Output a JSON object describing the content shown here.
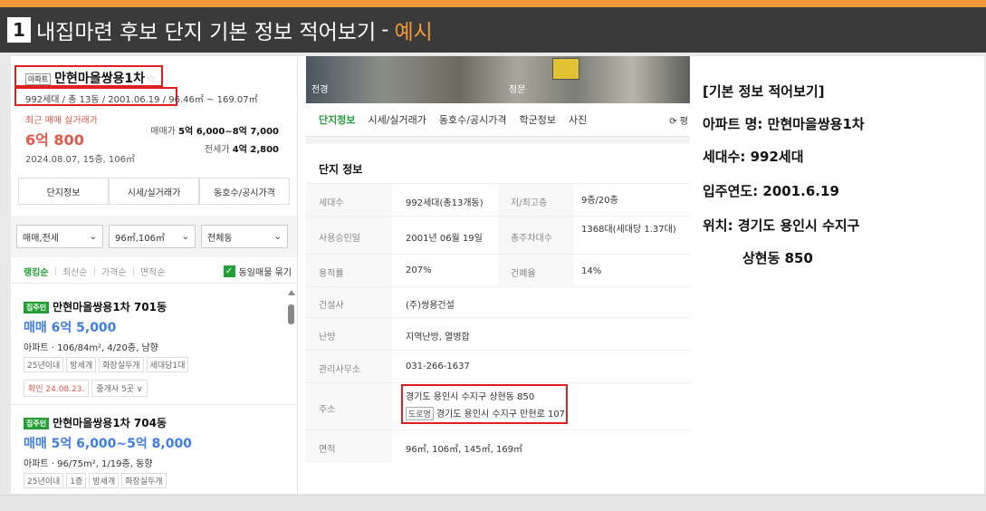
{
  "header": {
    "number": "1",
    "title": "내집마련 후보 단지 기본 정보 적어보기",
    "separator": "-",
    "example": "예시"
  },
  "left": {
    "type_tag": "아파트",
    "name": "만현마을쌍용1차",
    "star": "☆",
    "info": "992세대 / 총 13동 / 2001.06.19 / 96.46㎡ ~ 169.07㎡",
    "recent_label": "최근 매매 실거래가",
    "recent_price": "6억 800",
    "recent_date": "2024.08.07, 15층, 106㎡",
    "trade_label": "매매가",
    "trade_value": "5억 6,000~8억 7,000",
    "jeonse_label": "전세가",
    "jeonse_value": "4억 2,800",
    "buttons": [
      "단지정보",
      "시세/실거래가",
      "동호수/공시가격"
    ],
    "filters": [
      "매매,전세",
      "96㎡,106㎡",
      "전체동"
    ],
    "sort": [
      "랭킹순",
      "최신순",
      "가격순",
      "면적순"
    ],
    "same_check": "동일매물 묶기",
    "listings": [
      {
        "badge": "집주인",
        "title": "만현마을쌍용1차 701동",
        "price": "매매 6억 5,000",
        "detail": "아파트 · 106/84m², 4/20층, 남향",
        "tags": [
          "25년이내",
          "방세개",
          "화장실두개",
          "세대당1대"
        ],
        "confirm": "확인 24.08.23.",
        "agent": "중개사 5곳 ∨"
      },
      {
        "badge": "집주인",
        "title": "만현마을쌍용1차 704동",
        "price": "매매 5억 6,000~5억 8,000",
        "detail": "아파트 · 96/75m², 1/19층, 동향",
        "tags": [
          "25년이내",
          "1층",
          "방세개",
          "화장실두개"
        ]
      }
    ]
  },
  "middle": {
    "photo_labels": [
      "전경",
      "정문"
    ],
    "tabs": [
      "단지정보",
      "시세/실거래가",
      "동호수/공시가격",
      "학군정보",
      "사진"
    ],
    "tab_right": "⟳ 평",
    "section_title": "단지 정보",
    "rows": [
      {
        "k": "세대수",
        "v": "992세대(총13개동)",
        "k2": "저/최고층",
        "v2": "9층/20층"
      },
      {
        "k": "사용승인일",
        "v": "2001년 06월 19일",
        "k2": "총주차대수",
        "v2": "1368대(세대당 1.37대)"
      },
      {
        "k": "용적률",
        "v": "207%",
        "k2": "건폐율",
        "v2": "14%"
      },
      {
        "k": "건설사",
        "v": "(주)쌍용건설"
      },
      {
        "k": "난방",
        "v": "지역난방, 열병합"
      },
      {
        "k": "관리사무소",
        "v": "031-266-1637"
      },
      {
        "k": "주소",
        "v": "경기도 용인시 수지구 상현동 850",
        "road_tag": "도로명",
        "v_road": "경기도 용인시 수지구 만현로 107"
      },
      {
        "k": "면적",
        "v": "96㎡, 106㎡, 145㎡, 169㎡"
      }
    ]
  },
  "right": {
    "heading": "[기본 정보 적어보기]",
    "apt_name": "아파트 명: 만현마을쌍용1차",
    "households": "세대수: 992세대",
    "year": "입주연도: 2001.6.19",
    "location": "위치: 경기도 용인시 수지구",
    "location2": "상현동 850"
  },
  "colors": {
    "accent_orange": "#f29a38",
    "header_bg": "#3a3a3a",
    "highlight_red": "#e02020",
    "naver_green": "#23a035",
    "price_blue": "#3f7ee8"
  }
}
